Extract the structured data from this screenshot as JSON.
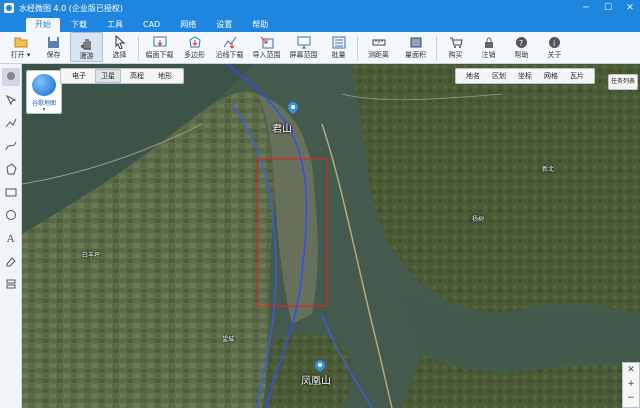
{
  "window": {
    "title": "水经微图 4.0 (企业版已授权)",
    "buttons": {
      "minimize": "─",
      "maximize": "☐",
      "close": "✕"
    }
  },
  "menu": {
    "tabs": [
      "开始",
      "下载",
      "工具",
      "CAD",
      "网络",
      "设置",
      "帮助"
    ],
    "active": "开始"
  },
  "ribbon": {
    "tools": [
      {
        "label": "打开 ▾",
        "icon": "folder-icon"
      },
      {
        "label": "保存",
        "icon": "save-icon"
      },
      {
        "label": "漫游",
        "icon": "hand-icon"
      },
      {
        "label": "选择",
        "icon": "cursor-icon"
      },
      {
        "label": "幅面下载",
        "icon": "frame-download-icon"
      },
      {
        "label": "多边形",
        "icon": "polygon-download-icon"
      },
      {
        "label": "沿线下载",
        "icon": "line-download-icon"
      },
      {
        "label": "导入范围",
        "icon": "import-range-icon"
      },
      {
        "label": "屏幕范围",
        "icon": "screen-range-icon"
      },
      {
        "label": "批量",
        "icon": "batch-icon"
      },
      {
        "label": "测距离",
        "icon": "measure-distance-icon"
      },
      {
        "label": "量面积",
        "icon": "measure-area-icon"
      },
      {
        "label": "购买",
        "icon": "cart-icon"
      },
      {
        "label": "注销",
        "icon": "lock-icon"
      },
      {
        "label": "帮助",
        "icon": "help-icon"
      },
      {
        "label": "关于",
        "icon": "info-icon"
      }
    ]
  },
  "map": {
    "logo_label": "谷歌地图",
    "map_types": [
      "电子",
      "卫星",
      "高程",
      "地形"
    ],
    "selected_map_type": "卫星",
    "layers": [
      "地名",
      "区划",
      "坐标",
      "网格",
      "瓦片"
    ],
    "task_list": "任务列表",
    "labels": [
      {
        "text": "君山"
      },
      {
        "text": "凤凰山"
      }
    ],
    "small_labels": [
      "杨树",
      "新北",
      "白羊坪",
      "望城"
    ],
    "colors": {
      "water": "#3f5a4a",
      "land": "#55663f",
      "river_line": "#2f4cff",
      "selection": "#d42a2a"
    }
  },
  "zoom": {
    "in": "+",
    "out": "−"
  }
}
